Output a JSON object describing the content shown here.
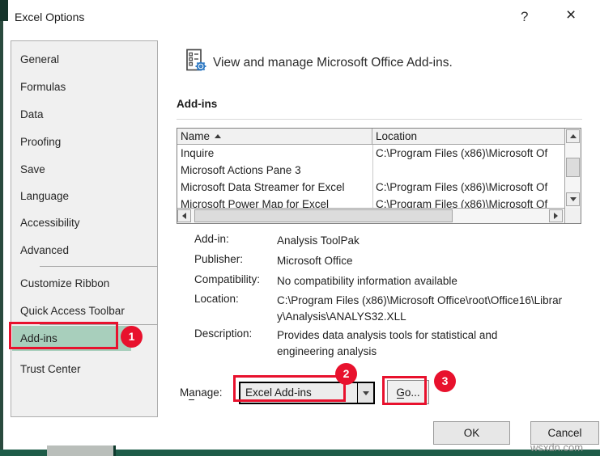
{
  "window": {
    "title": "Excel Options",
    "help_icon": "?",
    "close_icon": "×"
  },
  "sidebar": {
    "items": [
      "General",
      "Formulas",
      "Data",
      "Proofing",
      "Save",
      "Language",
      "Accessibility",
      "Advanced",
      "Customize Ribbon",
      "Quick Access Toolbar",
      "Add-ins",
      "Trust Center"
    ],
    "selected": "Add-ins"
  },
  "main": {
    "header": "View and manage Microsoft Office Add-ins.",
    "section_title": "Add-ins",
    "table": {
      "columns": [
        "Name",
        "Location"
      ],
      "rows": [
        {
          "name": "Inquire",
          "location": "C:\\Program Files (x86)\\Microsoft Of"
        },
        {
          "name": "Microsoft Actions Pane 3",
          "location": ""
        },
        {
          "name": "Microsoft Data Streamer for Excel",
          "location": "C:\\Program Files (x86)\\Microsoft Of"
        },
        {
          "name": "Microsoft Power Map for Excel",
          "location": "C:\\Program Files (x86)\\Microsoft Of"
        }
      ]
    },
    "details": [
      {
        "label": "Add-in:",
        "value": "Analysis ToolPak"
      },
      {
        "label": "Publisher:",
        "value": "Microsoft Office"
      },
      {
        "label": "Compatibility:",
        "value": "No compatibility information available"
      },
      {
        "label": "Location:",
        "value": "C:\\Program Files (x86)\\Microsoft Office\\root\\Office16\\Library\\Analysis\\ANALYS32.XLL"
      },
      {
        "label": "Description:",
        "value": "Provides data analysis tools for statistical and engineering analysis"
      }
    ],
    "manage": {
      "label": "Manage:",
      "selected": "Excel Add-ins",
      "go_label": "Go..."
    },
    "buttons": {
      "ok": "OK",
      "cancel": "Cancel"
    }
  },
  "annotations": {
    "step1": "1",
    "step2": "2",
    "step3": "3",
    "accent_color": "#e8112d"
  },
  "colors": {
    "highlight_green": "#a8cfbc",
    "excel_green": "#1e5c48"
  },
  "watermark": "wsxdn.com"
}
